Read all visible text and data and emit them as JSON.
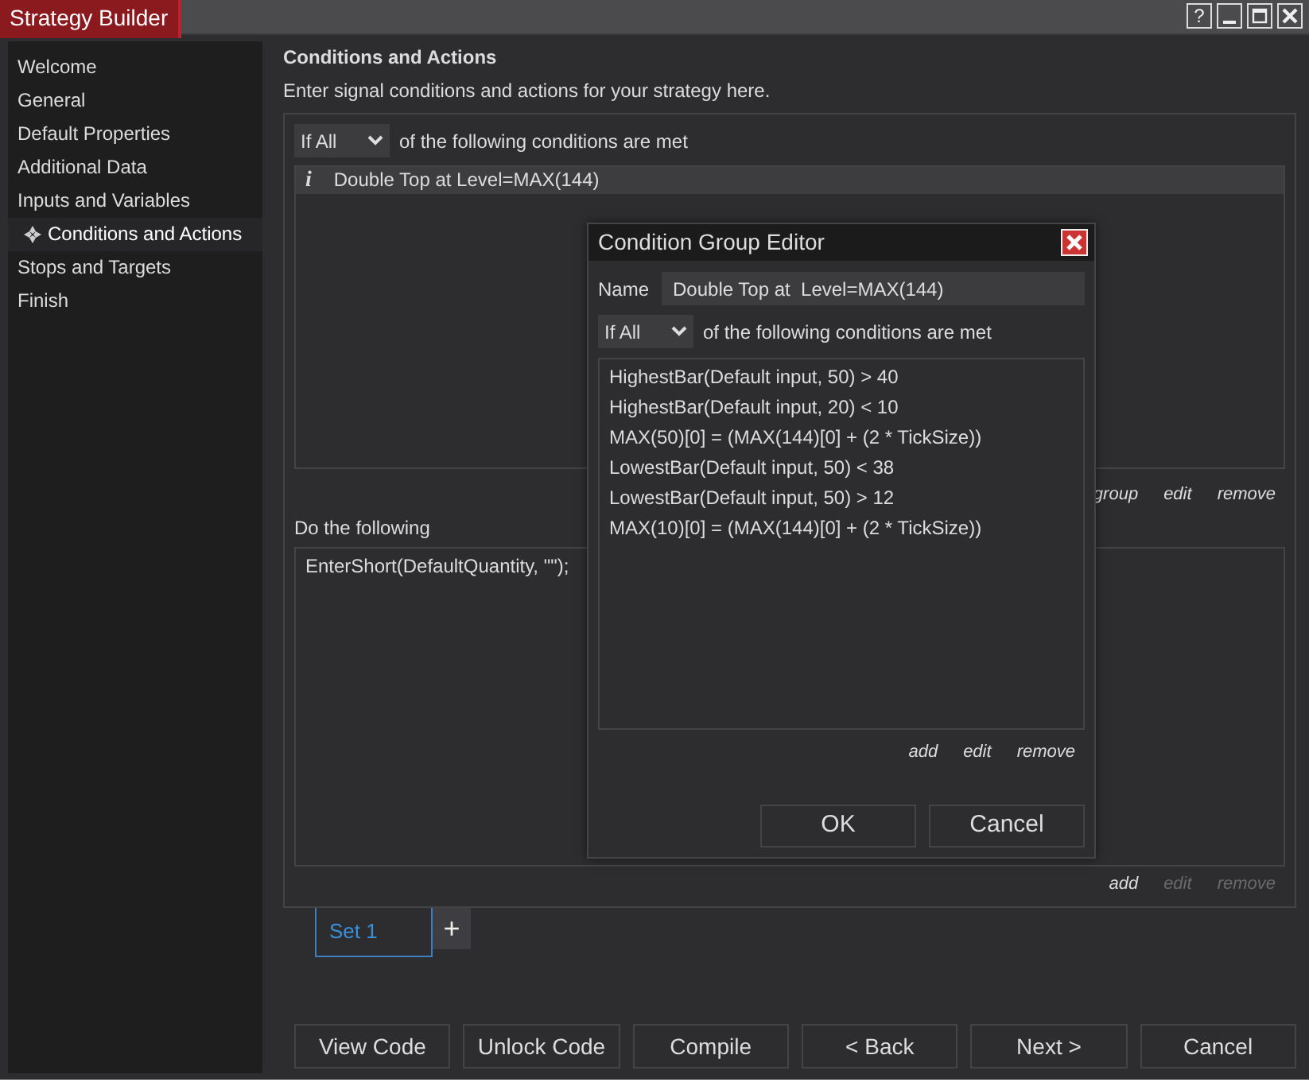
{
  "window": {
    "title": "Strategy Builder",
    "help_button": "?"
  },
  "sidebar": {
    "items": [
      {
        "label": "Welcome",
        "selected": false
      },
      {
        "label": "General",
        "selected": false
      },
      {
        "label": "Default Properties",
        "selected": false
      },
      {
        "label": "Additional Data",
        "selected": false
      },
      {
        "label": "Inputs and Variables",
        "selected": false
      },
      {
        "label": "Conditions and Actions",
        "selected": true
      },
      {
        "label": "Stops and Targets",
        "selected": false
      },
      {
        "label": "Finish",
        "selected": false
      }
    ]
  },
  "page": {
    "title": "Conditions and Actions",
    "description": "Enter signal conditions and actions for your strategy here."
  },
  "conditions": {
    "match_mode": "If All",
    "match_suffix": "of the following conditions are met",
    "items": [
      {
        "icon_text": "i",
        "text": "Double Top at  Level=MAX(144)",
        "selected": true
      }
    ],
    "links": [
      {
        "label": "group",
        "disabled": false
      },
      {
        "label": "edit",
        "disabled": false
      },
      {
        "label": "remove",
        "disabled": false
      }
    ]
  },
  "actions": {
    "label": "Do the following",
    "items": [
      {
        "text": "EnterShort(DefaultQuantity, \"\");",
        "selected": false
      }
    ],
    "links": [
      {
        "label": "add",
        "disabled": false
      },
      {
        "label": "edit",
        "disabled": true
      },
      {
        "label": "remove",
        "disabled": true
      }
    ]
  },
  "sets": {
    "tabs": [
      {
        "label": "Set 1",
        "selected": true
      }
    ],
    "add_button": "+"
  },
  "buttons": [
    "View Code",
    "Unlock Code",
    "Compile",
    "< Back",
    "Next >",
    "Cancel"
  ],
  "dialog": {
    "title": "Condition Group Editor",
    "name_label": "Name",
    "name_value": "Double Top at  Level=MAX(144)",
    "match_mode": "If All",
    "match_suffix": "of the following conditions are met",
    "conditions": [
      "HighestBar(Default input, 50) > 40",
      "HighestBar(Default input, 20) < 10",
      "MAX(50)[0] = (MAX(144)[0] + (2 * TickSize))",
      "LowestBar(Default input, 50) < 38",
      "LowestBar(Default input, 50) > 12",
      "MAX(10)[0] = (MAX(144)[0] + (2 * TickSize))"
    ],
    "links": [
      {
        "label": "add",
        "disabled": false
      },
      {
        "label": "edit",
        "disabled": false
      },
      {
        "label": "remove",
        "disabled": false
      }
    ],
    "buttons": [
      "OK",
      "Cancel"
    ]
  }
}
